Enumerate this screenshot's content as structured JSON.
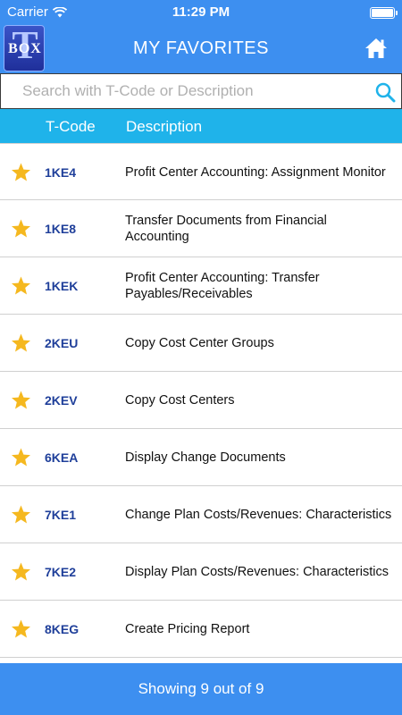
{
  "status_bar": {
    "carrier": "Carrier",
    "time": "11:29 PM"
  },
  "nav": {
    "logo_top": "T",
    "logo_bottom": "BOX",
    "title": "MY FAVORITES",
    "home_icon": "home-icon"
  },
  "search": {
    "placeholder": "Search with T-Code or Description",
    "value": ""
  },
  "columns": {
    "tcode": "T-Code",
    "description": "Description"
  },
  "colors": {
    "accent": "#3d8ff0",
    "header": "#1fb3ea",
    "star": "#f5b81f",
    "code": "#1f3f9a"
  },
  "rows": [
    {
      "code": "1KE4",
      "description": "Profit Center Accounting: Assignment Monitor"
    },
    {
      "code": "1KE8",
      "description": "Transfer Documents from Financial Accounting"
    },
    {
      "code": "1KEK",
      "description": "Profit Center Accounting: Transfer Payables/Receivables"
    },
    {
      "code": "2KEU",
      "description": "Copy Cost Center Groups"
    },
    {
      "code": "2KEV",
      "description": "Copy Cost Centers"
    },
    {
      "code": "6KEA",
      "description": "Display Change Documents"
    },
    {
      "code": "7KE1",
      "description": "Change Plan Costs/Revenues: Characteristics"
    },
    {
      "code": "7KE2",
      "description": "Display Plan Costs/Revenues: Characteristics"
    },
    {
      "code": "8KEG",
      "description": "Create Pricing Report"
    }
  ],
  "footer": {
    "text": "Showing 9 out of 9"
  }
}
